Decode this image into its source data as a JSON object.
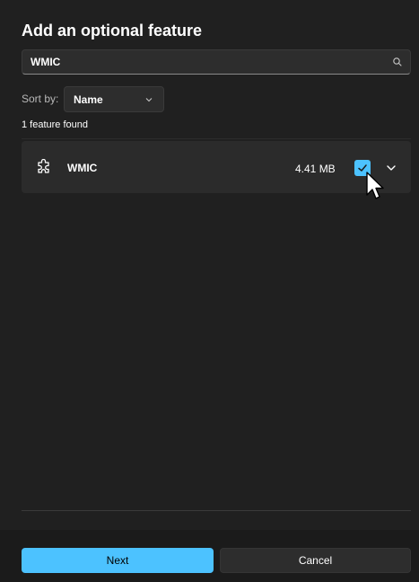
{
  "dialog": {
    "title": "Add an optional feature"
  },
  "search": {
    "value": "WMIC",
    "icon": "search-icon"
  },
  "sort": {
    "label": "Sort by:",
    "selected": "Name"
  },
  "results": {
    "count_text": "1 feature found",
    "features": [
      {
        "name": "WMIC",
        "size": "4.41 MB",
        "checked": true,
        "icon": "puzzle-icon"
      }
    ]
  },
  "footer": {
    "next_label": "Next",
    "cancel_label": "Cancel"
  },
  "colors": {
    "accent": "#4cc2ff",
    "background": "#202020"
  }
}
